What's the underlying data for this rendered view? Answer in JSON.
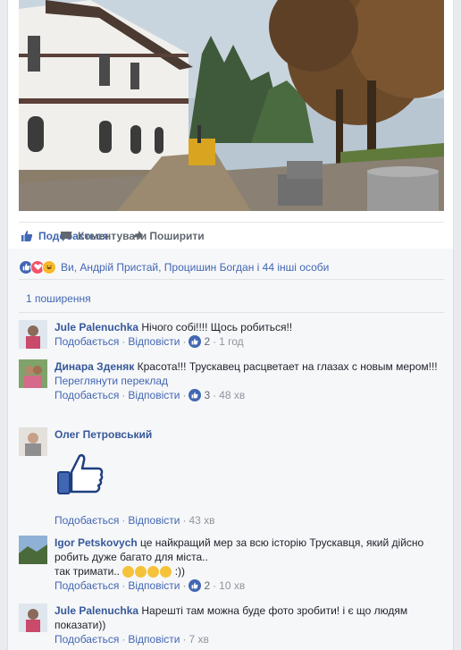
{
  "actions": {
    "like": "Подобається",
    "comment": "Коментувати",
    "share": "Поширити"
  },
  "reactions": {
    "names": "Ви, Андрій Пристай, Процишин Богдан і 44 інші особи",
    "icons": [
      "like-icon",
      "love-icon",
      "haha-icon"
    ]
  },
  "shares": "1 поширення",
  "comments": [
    {
      "author": "Jule Palenuchka",
      "text": "Нічого собі!!!! Щось робиться!!",
      "like_label": "Подобається",
      "reply_label": "Відповісти",
      "likes": "2",
      "time": "1 год"
    },
    {
      "author": "Динара Зденяк",
      "text": "Красота!!! Трускавец расцветает на глазах с новым мером!!!",
      "see_translation": "Переглянути переклад",
      "like_label": "Подобається",
      "reply_label": "Відповісти",
      "likes": "3",
      "time": "48 хв"
    },
    {
      "author": "Олег Петровський",
      "text": "",
      "sticker": "thumbs-up-sticker",
      "like_label": "Подобається",
      "reply_label": "Відповісти",
      "time": "43 хв"
    },
    {
      "author": "Igor Petskovych",
      "text": "це найкращий мер за всю історію Трускавця, який дійсно робить дуже багато для міста..",
      "text2": "так тримати..",
      "text2_suffix": ":))",
      "like_label": "Подобається",
      "reply_label": "Відповісти",
      "likes": "2",
      "time": "10 хв"
    },
    {
      "author": "Jule Palenuchka",
      "text": "Нарешті там можна буде фото зробити! і є що людям показати))",
      "like_label": "Подобається",
      "reply_label": "Відповісти",
      "time": "7 хв"
    }
  ],
  "colors": {
    "fb_blue": "#4267b2",
    "author_blue": "#365899",
    "grey_text": "#606770"
  }
}
